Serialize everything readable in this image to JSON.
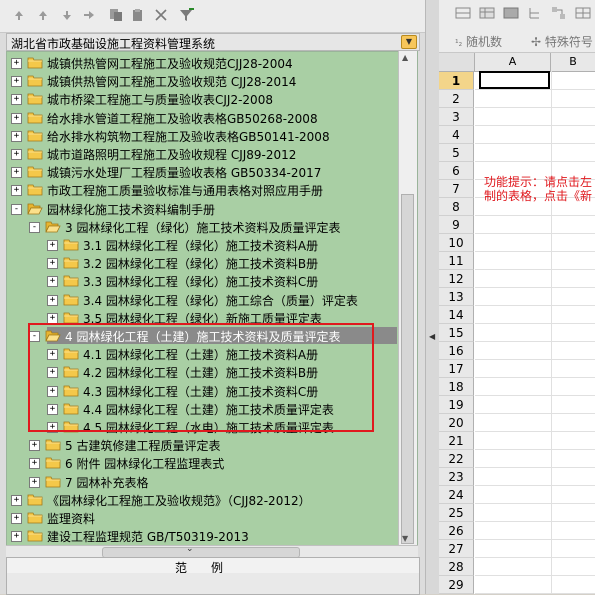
{
  "toolbar": {
    "buttons": [
      "arrow-up-icon",
      "arrow-up-icon",
      "arrow-down-icon",
      "arrow-right-icon",
      "copy-icon",
      "paste-icon",
      "close-icon",
      "filter-icon"
    ]
  },
  "combo": {
    "value": "湖北省市政基础设施工程资料管理系统"
  },
  "tree": {
    "nodes": [
      {
        "label": "城镇供热管网工程施工及验收规范CJJ28-2004",
        "level": 0,
        "exp": "+"
      },
      {
        "label": "城镇供热管网工程施工及验收规范 CJJ28-2014",
        "level": 0,
        "exp": "+"
      },
      {
        "label": "城市桥梁工程施工与质量验收表CJJ2-2008",
        "level": 0,
        "exp": "+"
      },
      {
        "label": "给水排水管道工程施工及验收表格GB50268-2008",
        "level": 0,
        "exp": "+"
      },
      {
        "label": "给水排水构筑物工程施工及验收表格GB50141-2008",
        "level": 0,
        "exp": "+"
      },
      {
        "label": "城市道路照明工程施工及验收规程 CJJ89-2012",
        "level": 0,
        "exp": "+"
      },
      {
        "label": "城镇污水处理厂工程质量验收表格 GB50334-2017",
        "level": 0,
        "exp": "+"
      },
      {
        "label": "市政工程施工质量验收标准与通用表格对照应用手册",
        "level": 0,
        "exp": "+"
      },
      {
        "label": "园林绿化施工技术资料编制手册",
        "level": 0,
        "exp": "-",
        "open": true
      },
      {
        "label": "3 园林绿化工程（绿化）施工技术资料及质量评定表",
        "level": 1,
        "exp": "-",
        "open": true
      },
      {
        "label": "3.1 园林绿化工程（绿化）施工技术资料A册",
        "level": 2,
        "exp": "+"
      },
      {
        "label": "3.2 园林绿化工程（绿化）施工技术资料B册",
        "level": 2,
        "exp": "+"
      },
      {
        "label": "3.3 园林绿化工程（绿化）施工技术资料C册",
        "level": 2,
        "exp": "+"
      },
      {
        "label": "3.4 园林绿化工程（绿化）施工综合（质量）评定表",
        "level": 2,
        "exp": "+"
      },
      {
        "label": "3.5 园林绿化工程（绿化）新施工质量评定表",
        "level": 2,
        "exp": "+"
      },
      {
        "label": "4 园林绿化工程（土建）施工技术资料及质量评定表",
        "level": 1,
        "exp": "-",
        "open": true,
        "selected": true
      },
      {
        "label": "4.1 园林绿化工程（土建）施工技术资料A册",
        "level": 2,
        "exp": "+"
      },
      {
        "label": "4.2 园林绿化工程（土建）施工技术资料B册",
        "level": 2,
        "exp": "+"
      },
      {
        "label": "4.3 园林绿化工程（土建）施工技术资料C册",
        "level": 2,
        "exp": "+"
      },
      {
        "label": "4.4 园林绿化工程（土建）施工技术质量评定表",
        "level": 2,
        "exp": "+"
      },
      {
        "label": "4.5 园林绿化工程（水电）施工技术质量评定表",
        "level": 2,
        "exp": "+"
      },
      {
        "label": "5 古建筑修建工程质量评定表",
        "level": 1,
        "exp": "+"
      },
      {
        "label": "6 附件 园林绿化工程监理表式",
        "level": 1,
        "exp": "+"
      },
      {
        "label": "7 园林补充表格",
        "level": 1,
        "exp": "+"
      },
      {
        "label": "《园林绿化工程施工及验收规范》（CJJ82-2012）",
        "level": 0,
        "exp": "+"
      },
      {
        "label": "监理资料",
        "level": 0,
        "exp": "+"
      },
      {
        "label": "建设工程监理规范 GB/T50319-2013",
        "level": 0,
        "exp": "+"
      }
    ]
  },
  "example": {
    "title": "范　　例"
  },
  "right_toolbar": {
    "btn1": "随机数",
    "btn2": "特殊符号"
  },
  "sheet": {
    "columns": [
      "A",
      "B"
    ],
    "rows": [
      "1",
      "2",
      "3",
      "4",
      "5",
      "6",
      "7",
      "8",
      "9",
      "10",
      "11",
      "12",
      "13",
      "14",
      "15",
      "16",
      "17",
      "18",
      "19",
      "20",
      "21",
      "22",
      "23",
      "24",
      "25",
      "26",
      "27",
      "28",
      "29"
    ],
    "hint_line1": "功能提示：请点击左",
    "hint_line2": "制的表格，点击《新"
  }
}
